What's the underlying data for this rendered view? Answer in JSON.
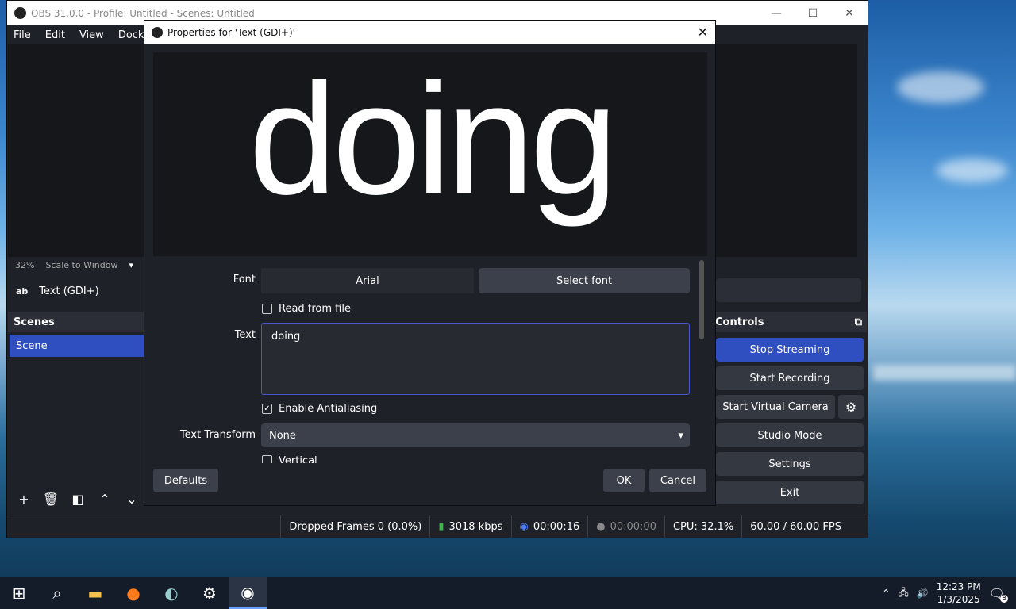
{
  "obs": {
    "title": "OBS 31.0.0 - Profile: Untitled - Scenes: Untitled",
    "menu": [
      "File",
      "Edit",
      "View",
      "Docks"
    ],
    "zoom_percent": "32%",
    "zoom_mode": "Scale to Window",
    "source_icon": "ab",
    "source_name": "Text (GDI+)",
    "scenes_header": "Scenes",
    "scene_selected": "Scene",
    "controls_header": "Controls",
    "controls": [
      "Stop Streaming",
      "Start Recording",
      "Start Virtual Camera",
      "Studio Mode",
      "Settings",
      "Exit"
    ],
    "accent": "#2f4ebf",
    "status": {
      "dropped": "Dropped Frames 0 (0.0%)",
      "bitrate": "3018 kbps",
      "stream_time": "00:00:16",
      "rec_time": "00:00:00",
      "cpu": "CPU: 32.1%",
      "fps": "60.00 / 60.00 FPS"
    }
  },
  "dialog": {
    "title": "Properties for 'Text (GDI+)'",
    "preview_text": "doing",
    "font_label": "Font",
    "font_value": "Arial",
    "select_font": "Select font",
    "read_from_file": "Read from file",
    "text_label": "Text",
    "text_value": "doing",
    "antialias": "Enable Antialiasing",
    "transform_label": "Text Transform",
    "transform_value": "None",
    "vertical": "Vertical",
    "defaults": "Defaults",
    "ok": "OK",
    "cancel": "Cancel"
  },
  "taskbar": {
    "time": "12:23 PM",
    "date": "1/3/2025",
    "notifications": "8"
  }
}
